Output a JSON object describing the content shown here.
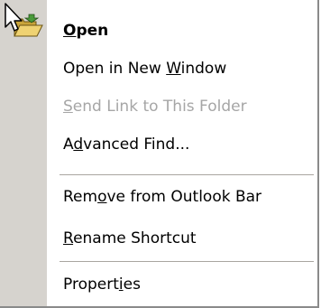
{
  "menu": {
    "items": [
      {
        "pre": "",
        "key": "O",
        "post": "pen",
        "disabled": false,
        "bold": true
      },
      {
        "pre": "Open in New ",
        "key": "W",
        "post": "indow",
        "disabled": false,
        "bold": false
      },
      {
        "pre": "",
        "key": "S",
        "post": "end Link to This Folder",
        "disabled": true,
        "bold": false
      },
      {
        "pre": "A",
        "key": "d",
        "post": "vanced Find...",
        "disabled": false,
        "bold": false
      },
      {
        "pre": "Rem",
        "key": "o",
        "post": "ve from Outlook Bar",
        "disabled": false,
        "bold": false
      },
      {
        "pre": "",
        "key": "R",
        "post": "ename Shortcut",
        "disabled": false,
        "bold": false
      },
      {
        "pre": "Propert",
        "key": "i",
        "post": "es",
        "disabled": false,
        "bold": false
      }
    ]
  },
  "icons": {
    "open_item_icon": "open-folder-icon",
    "pointer": "mouse-pointer-icon"
  },
  "colors": {
    "gutter": "#d6d3ce",
    "disabled_text": "#a6a6a6",
    "separator": "#a9a6a0",
    "folder": "#e8c75a"
  }
}
